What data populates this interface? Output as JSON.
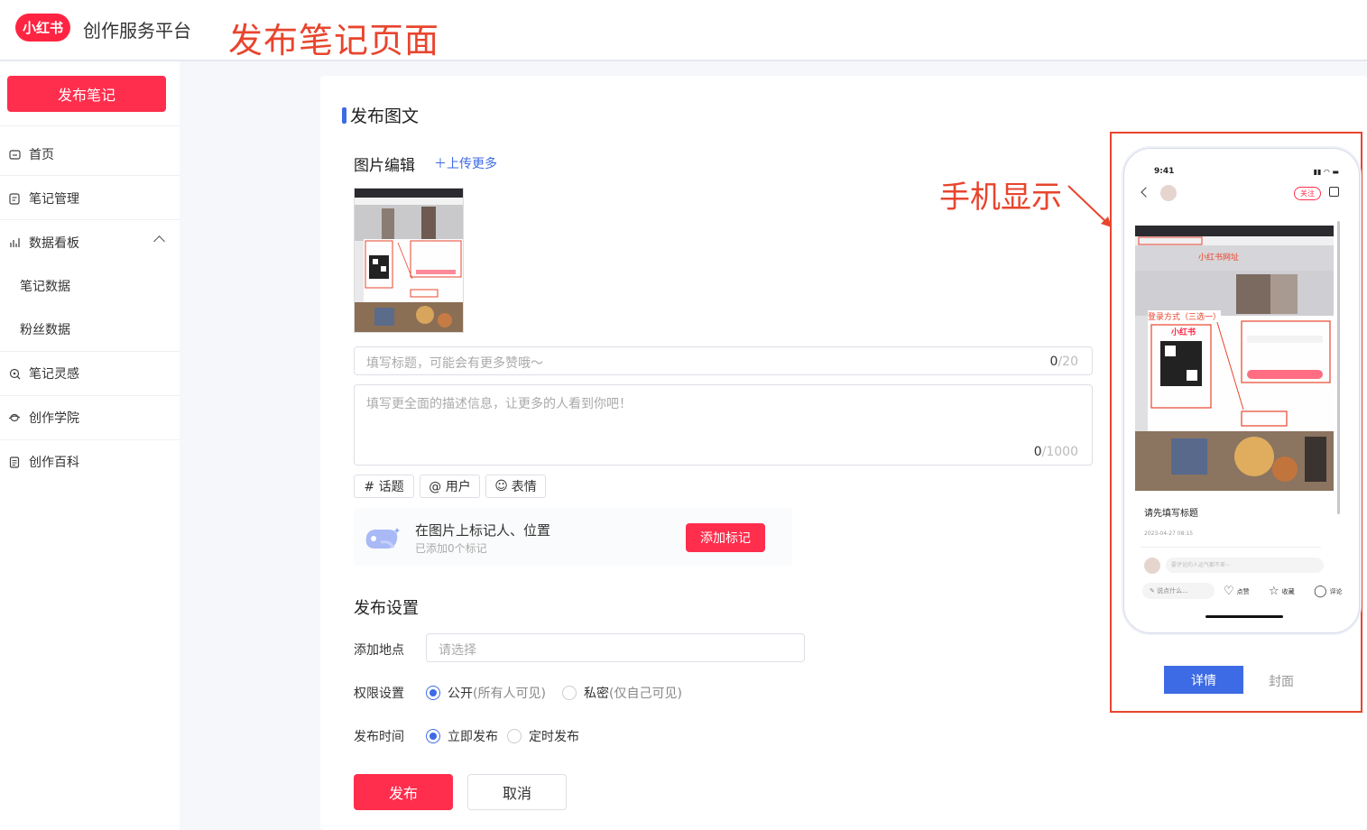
{
  "header": {
    "logo_text": "小红书",
    "platform_name": "创作服务平台",
    "annotation_title": "发布笔记页面"
  },
  "sidebar": {
    "publish_button": "发布笔记",
    "items": [
      {
        "label": "首页",
        "icon": "home-icon"
      },
      {
        "label": "笔记管理",
        "icon": "note-icon"
      },
      {
        "label": "数据看板",
        "icon": "chart-icon",
        "expanded": true
      },
      {
        "label": "笔记数据"
      },
      {
        "label": "粉丝数据"
      },
      {
        "label": "笔记灵感",
        "icon": "inspiration-icon"
      },
      {
        "label": "创作学院",
        "icon": "academy-icon"
      },
      {
        "label": "创作百科",
        "icon": "wiki-icon"
      }
    ]
  },
  "main": {
    "section_title": "发布图文",
    "image_edit_label": "图片编辑",
    "upload_more": "上传更多",
    "title_input": {
      "placeholder": "填写标题，可能会有更多赞哦～",
      "count": "0",
      "max": "/20"
    },
    "desc_input": {
      "placeholder": "填写更全面的描述信息，让更多的人看到你吧！",
      "count": "0",
      "max": "/1000"
    },
    "tag_buttons": [
      "# 话题",
      "@ 用户",
      "表情"
    ],
    "mark": {
      "title": "在图片上标记人、位置",
      "subtitle": "已添加0个标记",
      "button": "添加标记"
    },
    "settings_title": "发布设置",
    "location": {
      "label": "添加地点",
      "placeholder": "请选择"
    },
    "permission": {
      "label": "权限设置",
      "options": [
        {
          "main": "公开",
          "note": "(所有人可见)",
          "selected": true
        },
        {
          "main": "私密",
          "note": "(仅自己可见)",
          "selected": false
        }
      ]
    },
    "publish_time": {
      "label": "发布时间",
      "options": [
        {
          "main": "立即发布",
          "selected": true
        },
        {
          "main": "定时发布",
          "selected": false
        }
      ]
    },
    "publish_button": "发布",
    "cancel_button": "取消"
  },
  "preview": {
    "annotation_label": "手机显示",
    "phone": {
      "time": "9:41",
      "follow": "关注",
      "image_annot_url": "小红书网址",
      "image_annot_login": "登录方式（三选一）",
      "image_brand": "小红书",
      "title": "请先填写标题",
      "date": "2023-04-27 08:15",
      "comment_placeholder": "要评论的人运气都不差~",
      "say_something": "说点什么...",
      "like": "点赞",
      "collect": "收藏",
      "comment": "评论"
    },
    "tabs": [
      "详情",
      "封面"
    ]
  },
  "colors": {
    "brand_red": "#ff2e4d",
    "accent_blue": "#3d6be5",
    "annotation_red": "#e8452e"
  }
}
